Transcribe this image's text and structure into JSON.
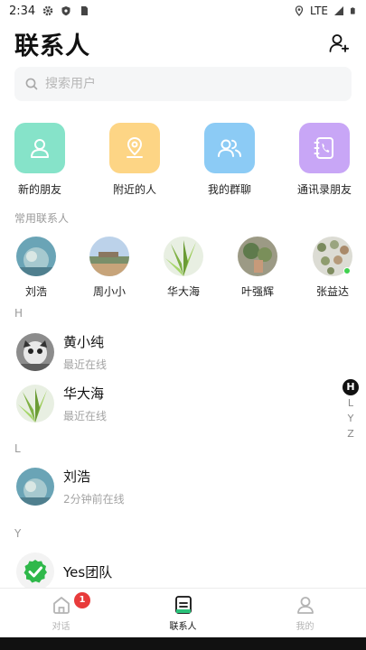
{
  "status_bar": {
    "time": "2:34",
    "network": "LTE"
  },
  "header": {
    "title": "联系人"
  },
  "search": {
    "placeholder": "搜索用户"
  },
  "actions": [
    {
      "label": "新的朋友",
      "color": "#86e3c9",
      "icon": "person-icon"
    },
    {
      "label": "附近的人",
      "color": "#fdd585",
      "icon": "location-pin-icon"
    },
    {
      "label": "我的群聊",
      "color": "#8ccbf5",
      "icon": "group-icon"
    },
    {
      "label": "通讯录朋友",
      "color": "#c8a6f6",
      "icon": "phone-book-icon"
    }
  ],
  "frequent": {
    "label": "常用联系人",
    "items": [
      {
        "name": "刘浩"
      },
      {
        "name": "周小小"
      },
      {
        "name": "华大海"
      },
      {
        "name": "叶强辉"
      },
      {
        "name": "张益达",
        "online": true
      }
    ]
  },
  "groups": [
    {
      "letter": "H",
      "contacts": [
        {
          "name": "黄小纯",
          "status": "最近在线"
        },
        {
          "name": "华大海",
          "status": "最近在线"
        }
      ]
    },
    {
      "letter": "L",
      "contacts": [
        {
          "name": "刘浩",
          "status": "2分钟前在线"
        }
      ]
    },
    {
      "letter": "Y",
      "contacts": [
        {
          "name": "Yes团队",
          "status": ""
        }
      ]
    }
  ],
  "alpha_index": {
    "active": "H",
    "letters": [
      "L",
      "Y",
      "Z"
    ]
  },
  "tabs": [
    {
      "label": "对话",
      "badge": "1",
      "active": false
    },
    {
      "label": "联系人",
      "active": true
    },
    {
      "label": "我的",
      "active": false
    }
  ],
  "colors": {
    "accent": "#111111",
    "badge": "#e83b3b",
    "online": "#3fd14f"
  }
}
